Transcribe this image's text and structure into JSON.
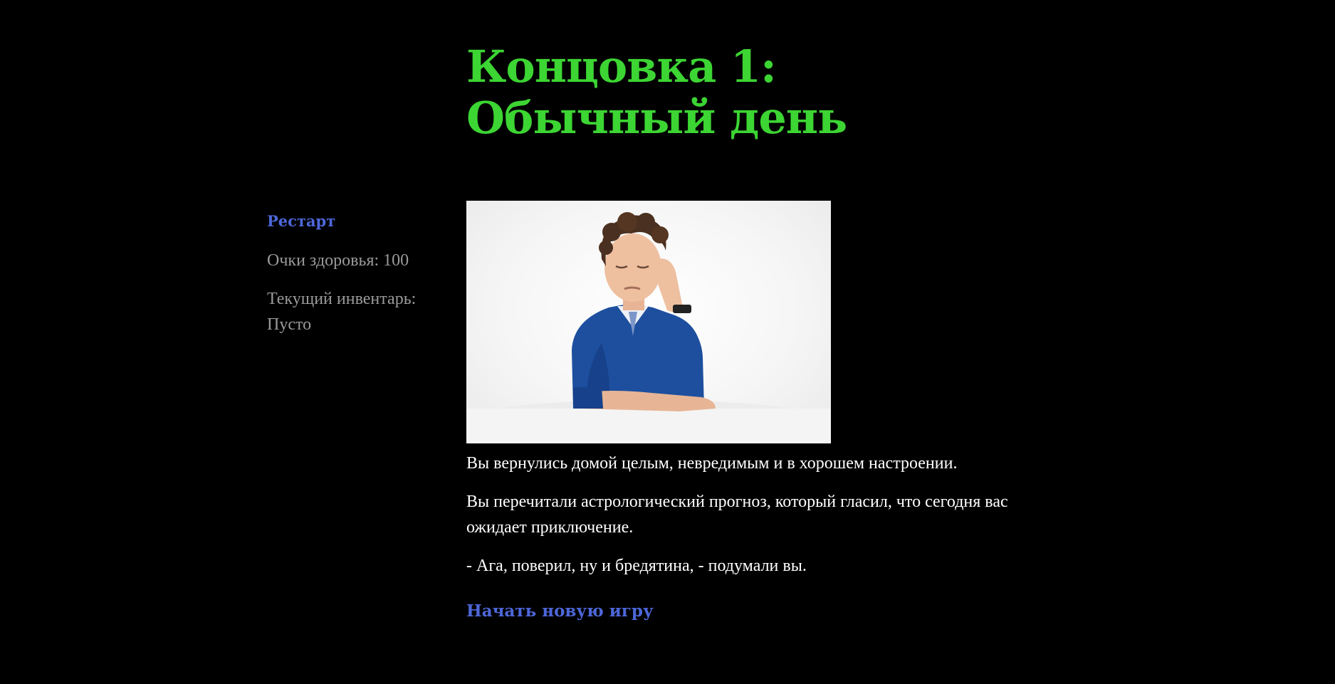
{
  "title": {
    "line1": "Концовка 1:",
    "line2": "Обычный день"
  },
  "sidebar": {
    "restart_label": "Рестарт",
    "health_label": "Очки здоровья: 100",
    "inventory_label": "Текущий инвентарь:",
    "inventory_value": "Пусто"
  },
  "story": {
    "paragraphs": [
      "Вы вернулись домой целым, невредимым и в хорошем настроении.",
      "Вы перечитали астрологический прогноз, который гласил, что сегодня вас ожидает приключение.",
      "- Ага, поверил, ну и бредятина, - подумали вы."
    ]
  },
  "actions": {
    "new_game_label": "Начать новую игру"
  },
  "colors": {
    "background": "#000000",
    "title": "#3cd533",
    "link": "#4d67d9",
    "stat_text": "#9a9a9a",
    "body_text": "#ffffff"
  }
}
